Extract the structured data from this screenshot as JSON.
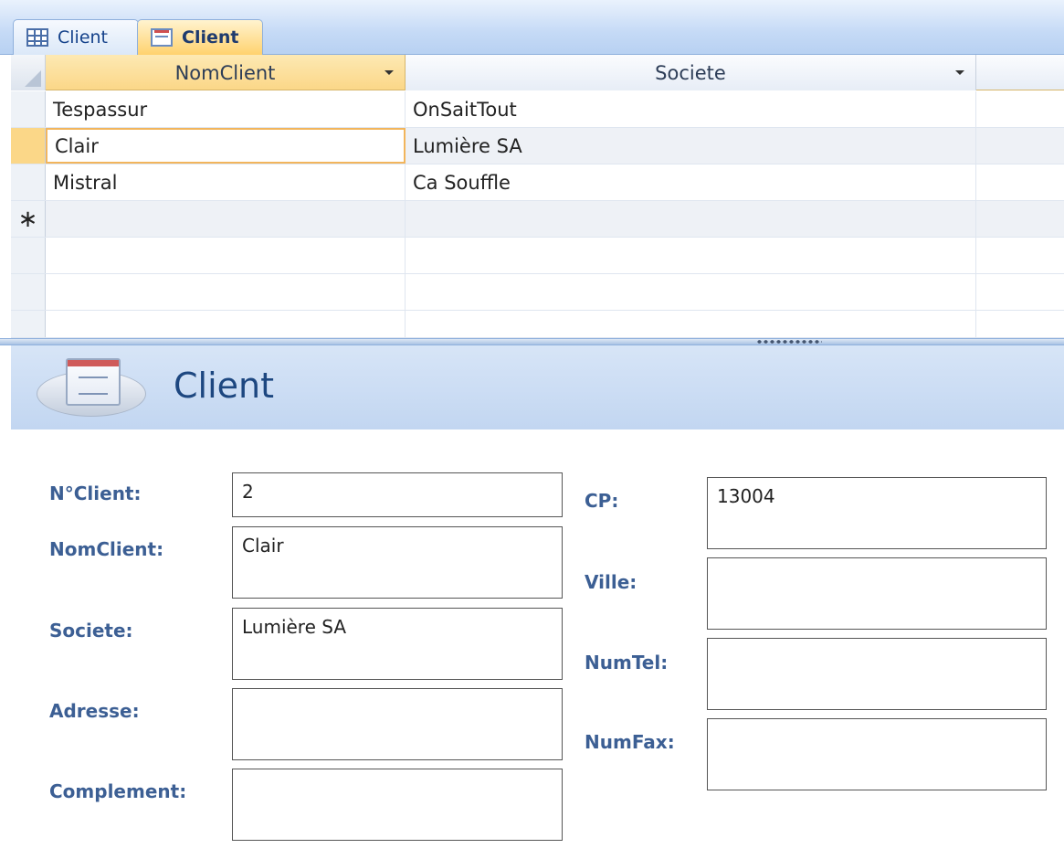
{
  "tabs": [
    {
      "label": "Client",
      "icon": "table-icon"
    },
    {
      "label": "Client",
      "icon": "form-icon"
    }
  ],
  "datasheet": {
    "columns": [
      "NomClient",
      "Societe"
    ],
    "rows": [
      {
        "NomClient": "Tespassur",
        "Societe": "OnSaitTout"
      },
      {
        "NomClient": "Clair",
        "Societe": "Lumière SA"
      },
      {
        "NomClient": "Mistral",
        "Societe": "Ca Souffle"
      }
    ],
    "new_row_marker": "∗"
  },
  "form": {
    "title": "Client",
    "labels": {
      "num_client": "N°Client:",
      "nom_client": "NomClient:",
      "societe": "Societe:",
      "adresse": "Adresse:",
      "complement": "Complement:",
      "cp": "CP:",
      "ville": "Ville:",
      "num_tel": "NumTel:",
      "num_fax": "NumFax:"
    },
    "values": {
      "num_client": "2",
      "nom_client": "Clair",
      "societe": "Lumière SA",
      "adresse": "",
      "complement": "",
      "cp": "13004",
      "ville": "",
      "num_tel": "",
      "num_fax": ""
    }
  },
  "colors": {
    "accent": "#fbd788",
    "label": "#3c5f94",
    "title": "#1d4780"
  }
}
